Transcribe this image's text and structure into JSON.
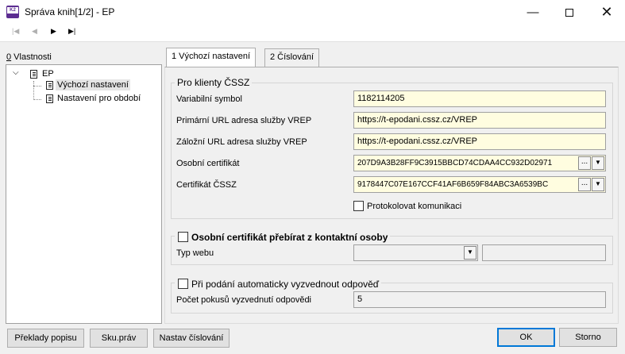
{
  "window": {
    "title": "Správa knih[1/2] - EP",
    "minimize": "—",
    "close": "✕"
  },
  "nav": {
    "first": "|◀",
    "prev": "◀",
    "next": "▶",
    "last": "▶|"
  },
  "tree": {
    "header_accel": "0",
    "header_rest": " Vlastnosti",
    "expander": "⌵",
    "root": "EP",
    "items": [
      "Výchozí nastavení",
      "Nastavení pro období"
    ]
  },
  "tabs": [
    {
      "label": "1 Výchozí nastavení"
    },
    {
      "label": "2 Číslování"
    }
  ],
  "cssz": {
    "title": "Pro klienty ČSSZ",
    "variabilni_label": "Variabilní symbol",
    "variabilni_value": "1182114205",
    "primarni_label": "Primární URL adresa služby VREP",
    "primarni_value": "https://t-epodani.cssz.cz/VREP",
    "zalozni_label": "Záložní URL adresa služby VREP",
    "zalozni_value": "https://t-epodani.cssz.cz/VREP",
    "osobni_label": "Osobní certifikát",
    "osobni_value": "207D9A3B28FF9C3915BBCD74CDAA4CC932D02971",
    "cert_label": "Certifikát ČSSZ",
    "cert_value": "9178447C07E167CCF41AF6B659F84ABC3A6539BC",
    "ellipsis": "...",
    "dropdown": "▼",
    "protokol_label": "Protokolovat komunikaci"
  },
  "contact": {
    "title": "Osobní certifikát přebírat z kontaktní osoby",
    "typ_webu_label": "Typ webu",
    "typ_webu_value": "",
    "typ_webu_extra": ""
  },
  "reply": {
    "title": "Při podání automaticky vyzvednout odpověď",
    "pocet_label": "Počet pokusů vyzvednutí odpovědi",
    "pocet_value": "5"
  },
  "buttons": {
    "preklady": "Překlady popisu",
    "skuprav": "Sku.práv",
    "nastav": "Nastav číslování",
    "ok": "OK",
    "storno": "Storno"
  }
}
